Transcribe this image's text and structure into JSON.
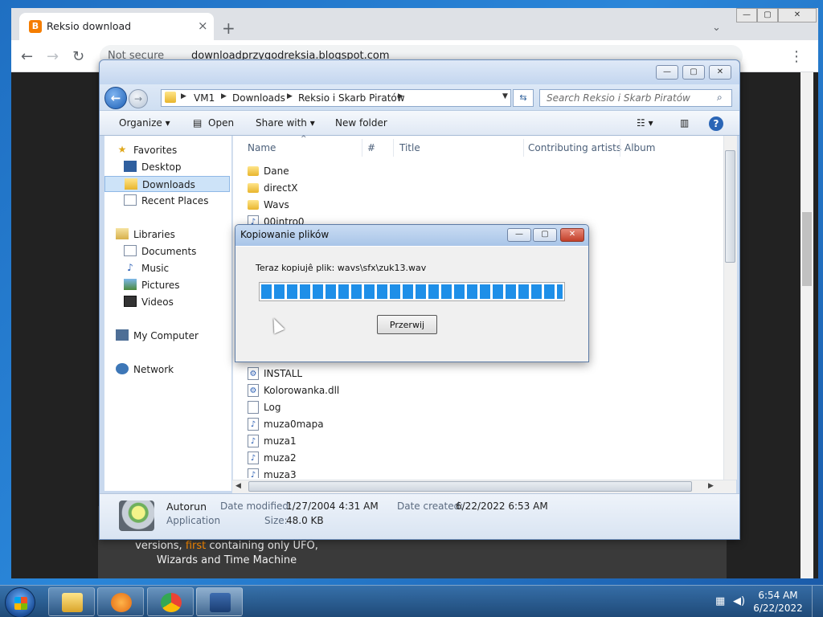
{
  "browser": {
    "tab_title": "Reksio download",
    "tab_close": "×",
    "new_tab": "+",
    "secure_label": "Not secure",
    "url": "downloadprzygodreksia.blogspot.com",
    "nav": {
      "back": "←",
      "forward": "→",
      "reload": "↻",
      "menu": "⋮"
    },
    "window_controls": {
      "minimize": "—",
      "maximize": "▢",
      "close": "✕"
    },
    "page_text": {
      "line1_pre": "versions, ",
      "line1_highlight": "first",
      "line1_post": " containing only UFO,",
      "line2": "Wizards and Time Machine"
    },
    "highlight_color": "#ff8c00"
  },
  "explorer": {
    "window_controls": {
      "minimize": "—",
      "maximize": "▢",
      "close": "✕"
    },
    "breadcrumbs": [
      "VM1",
      "Downloads",
      "Reksio i Skarb Piratów"
    ],
    "search_placeholder": "Search Reksio i Skarb Piratów",
    "commands": {
      "organize": "Organize ▾",
      "open": "Open",
      "share": "Share with ▾",
      "new_folder": "New folder"
    },
    "nav": {
      "favorites": "Favorites",
      "desktop": "Desktop",
      "downloads": "Downloads",
      "recent": "Recent Places",
      "libraries": "Libraries",
      "documents": "Documents",
      "music": "Music",
      "pictures": "Pictures",
      "videos": "Videos",
      "computer": "My Computer",
      "network": "Network"
    },
    "columns": {
      "name": "Name",
      "num": "#",
      "title": "Title",
      "artists": "Contributing artists",
      "album": "Album"
    },
    "files_top": [
      {
        "name": "Dane",
        "type": "folder"
      },
      {
        "name": "directX",
        "type": "folder"
      },
      {
        "name": "Wavs",
        "type": "folder"
      },
      {
        "name": "00intro0",
        "type": "audio"
      }
    ],
    "files_bottom": [
      {
        "name": "INSTALL",
        "type": "setup"
      },
      {
        "name": "Kolorowanka.dll",
        "type": "dll"
      },
      {
        "name": "Log",
        "type": "text"
      },
      {
        "name": "muza0mapa",
        "type": "audio"
      },
      {
        "name": "muza1",
        "type": "audio"
      },
      {
        "name": "muza2",
        "type": "audio"
      },
      {
        "name": "muza3",
        "type": "audio"
      }
    ],
    "details": {
      "name": "Autorun",
      "type": "Application",
      "modified_label": "Date modified:",
      "modified_value": "1/27/2004 4:31 AM",
      "created_label": "Date created:",
      "created_value": "6/22/2022 6:53 AM",
      "size_label": "Size:",
      "size_value": "48.0 KB"
    }
  },
  "dialog": {
    "title": "Kopiowanie plików",
    "status": "Teraz kopiujê plik: wavs\\sfx\\zuk13.wav",
    "progress_fraction": 1.0,
    "button": "Przerwij",
    "progress_color": "#1e8fe8"
  },
  "taskbar": {
    "time": "6:54 AM",
    "date": "6/22/2022"
  }
}
